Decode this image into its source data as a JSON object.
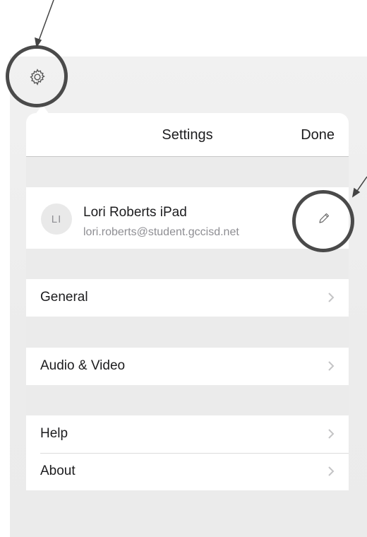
{
  "header": {
    "title": "Settings",
    "done_label": "Done"
  },
  "profile": {
    "initials": "LI",
    "name": "Lori Roberts iPad",
    "email": "lori.roberts@student.gccisd.net"
  },
  "menu": {
    "general": "General",
    "audio_video": "Audio & Video",
    "help": "Help",
    "about": "About"
  },
  "icons": {
    "settings": "gear-icon",
    "edit": "pencil-icon",
    "chevron": "chevron-right-icon"
  },
  "colors": {
    "annotation": "#4a4a4a",
    "secondary_text": "#8e8e93",
    "chevron": "#c4c4c6"
  }
}
